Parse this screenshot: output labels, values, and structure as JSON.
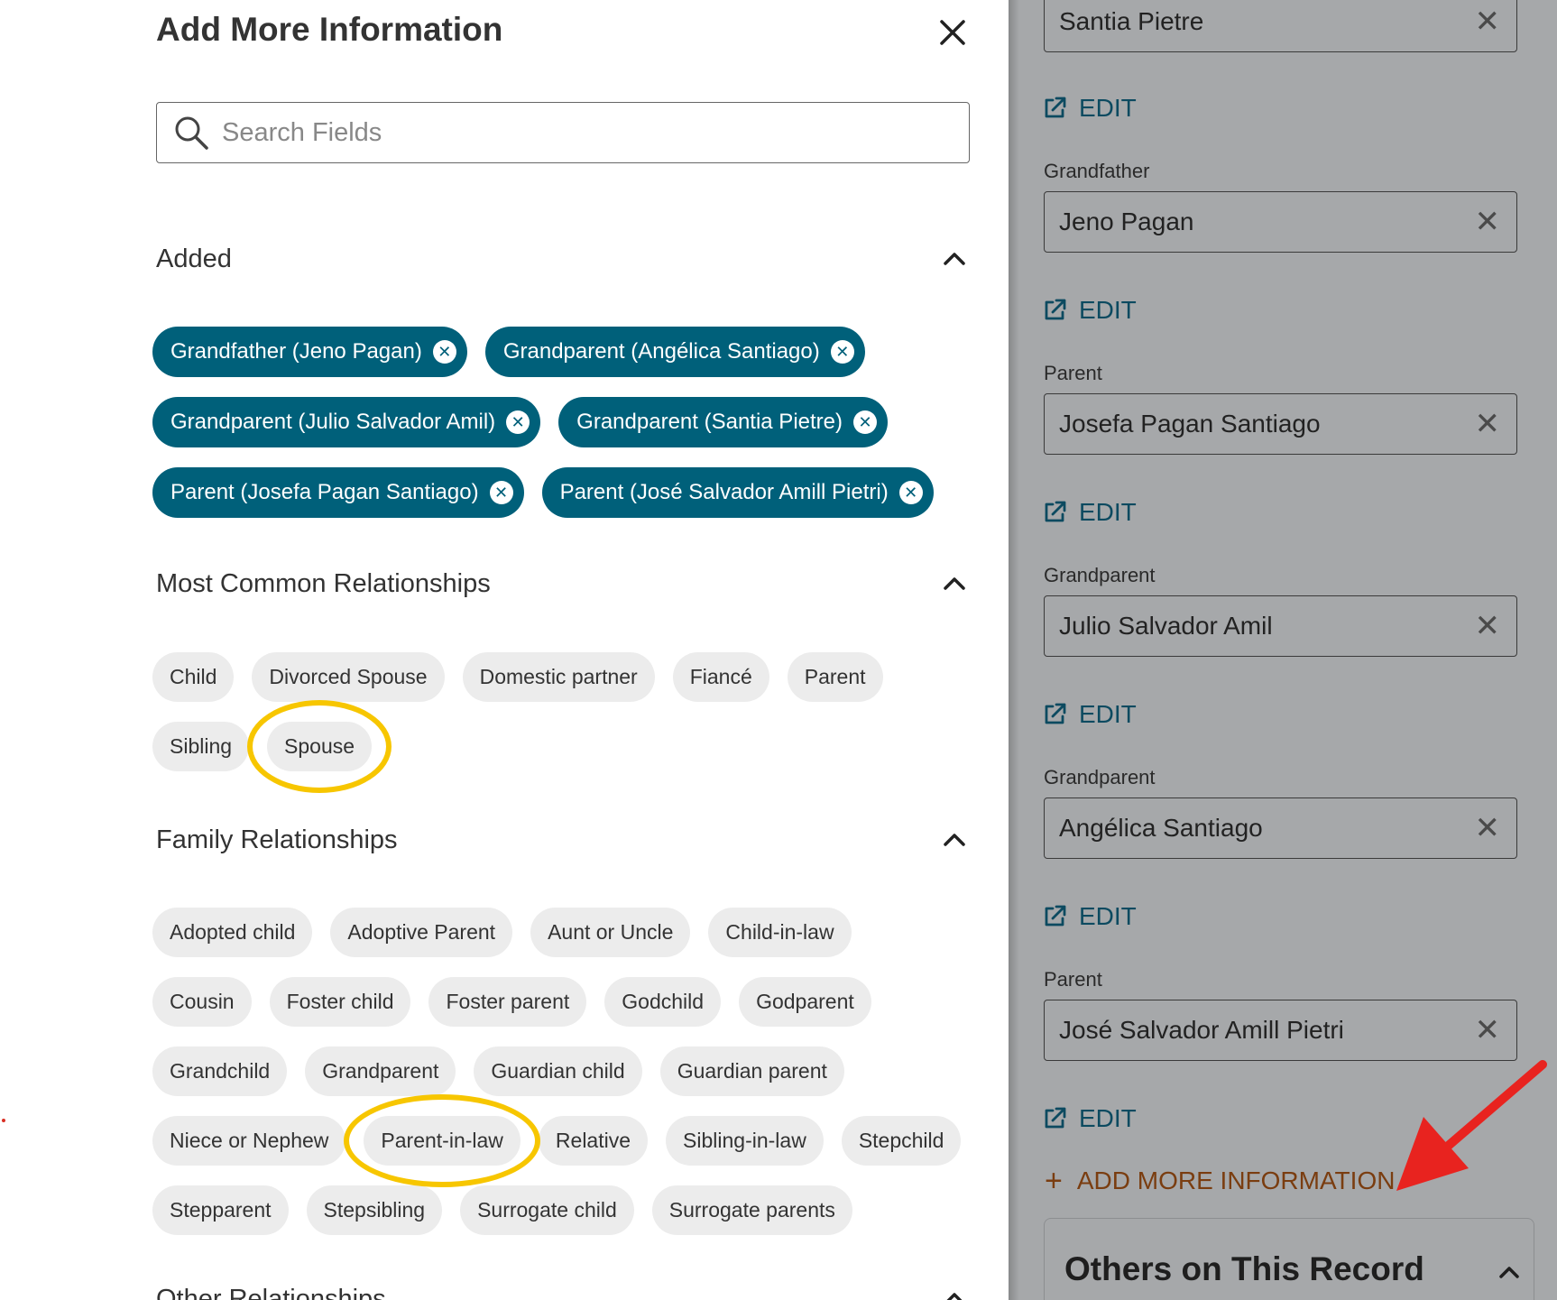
{
  "drawer": {
    "title": "Add More Information",
    "search": {
      "placeholder": "Search Fields",
      "value": ""
    },
    "sections": {
      "added": {
        "label": "Added",
        "chips": [
          "Grandfather (Jeno Pagan)",
          "Grandparent (Angélica Santiago)",
          "Grandparent (Julio Salvador Amil)",
          "Grandparent (Santia Pietre)",
          "Parent (Josefa Pagan Santiago)",
          "Parent (José Salvador Amill Pietri)"
        ]
      },
      "most_common": {
        "label": "Most Common Relationships",
        "chips": [
          "Child",
          "Divorced Spouse",
          "Domestic partner",
          "Fiancé",
          "Parent",
          "Sibling",
          "Spouse"
        ]
      },
      "family": {
        "label": "Family Relationships",
        "chips": [
          "Adopted child",
          "Adoptive Parent",
          "Aunt or Uncle",
          "Child-in-law",
          "Cousin",
          "Foster child",
          "Foster parent",
          "Godchild",
          "Godparent",
          "Grandchild",
          "Grandparent",
          "Guardian child",
          "Guardian parent",
          "Niece or Nephew",
          "Parent-in-law",
          "Relative",
          "Sibling-in-law",
          "Stepchild",
          "Stepparent",
          "Stepsibling",
          "Surrogate child",
          "Surrogate parents"
        ]
      },
      "other": {
        "label": "Other Relationships"
      }
    }
  },
  "right_panel": {
    "top_field_value": "Santia Pietre",
    "edit_label": "EDIT",
    "fields": [
      {
        "label": "Grandfather",
        "value": "Jeno Pagan"
      },
      {
        "label": "Parent",
        "value": "Josefa Pagan Santiago"
      },
      {
        "label": "Grandparent",
        "value": "Julio Salvador Amil"
      },
      {
        "label": "Grandparent",
        "value": "Angélica Santiago"
      },
      {
        "label": "Parent",
        "value": "José Salvador Amill Pietri"
      }
    ],
    "add_more_label": "ADD MORE INFORMATION",
    "others_title": "Others on This Record"
  },
  "annotations": {
    "highlighted_chips": [
      "Spouse",
      "Parent-in-law"
    ],
    "ring_color": "#f7c600",
    "arrow_color": "#e8231f",
    "arrow_target": "ADD MORE INFORMATION"
  },
  "colors": {
    "added_chip_bg": "#00607a",
    "chip_bg": "#ececec",
    "edit_link": "#0c4a60",
    "add_more": "#7a3d10",
    "overlay": "#a6a8aa"
  }
}
